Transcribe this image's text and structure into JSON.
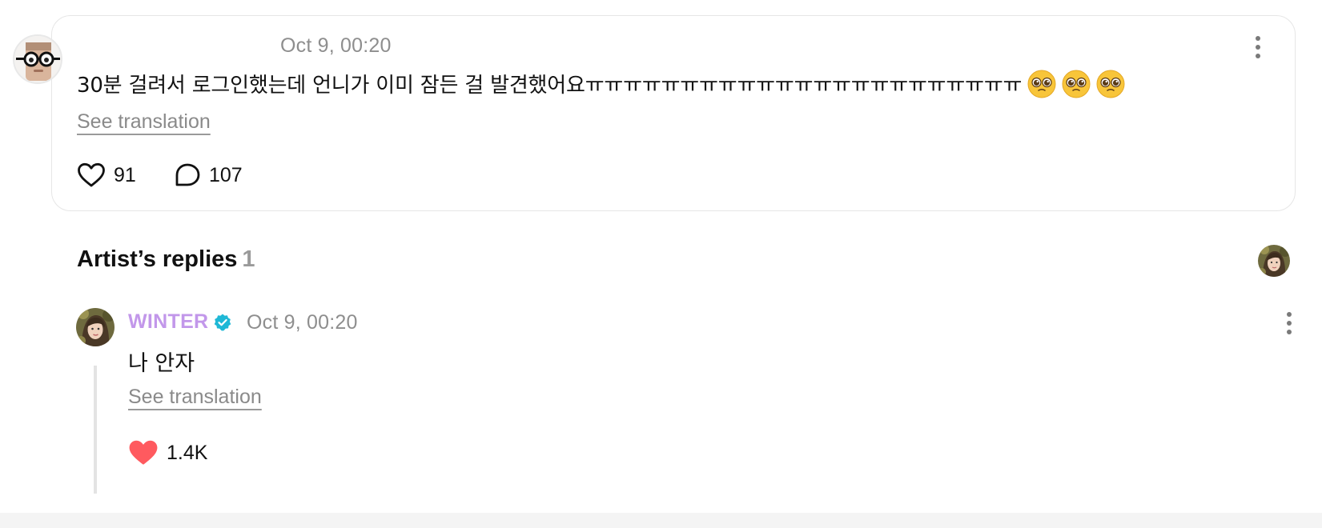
{
  "post": {
    "date": "Oct 9, 00:20",
    "text": "30분 걸려서 로그인했는데 언니가 이미 잠든 걸 발견했어요ㅠㅠㅠㅠㅠㅠㅠㅠㅠㅠㅠㅠㅠㅠㅠㅠㅠㅠㅠㅠㅠㅠㅠ",
    "emojis": [
      "pleading-face-emoji",
      "pleading-face-emoji",
      "pleading-face-emoji"
    ],
    "see_translation": "See translation",
    "likes": "91",
    "comments": "107",
    "icons": {
      "like": "heart-outline-icon",
      "comment": "speech-bubble-icon",
      "more": "vertical-ellipsis-icon"
    }
  },
  "artist_replies": {
    "heading": "Artist’s replies",
    "count": "1",
    "replies": [
      {
        "author": "WINTER",
        "verified": true,
        "date": "Oct 9, 00:20",
        "text": "나 안자",
        "see_translation": "See translation",
        "likes": "1.4K",
        "liked": true
      }
    ]
  },
  "colors": {
    "artist_name": "#c297ea",
    "verified_badge": "#1fb8d6",
    "liked_heart": "#ff5a5f",
    "meta_text": "#8e8e8e",
    "card_border": "#e6e6e6"
  }
}
